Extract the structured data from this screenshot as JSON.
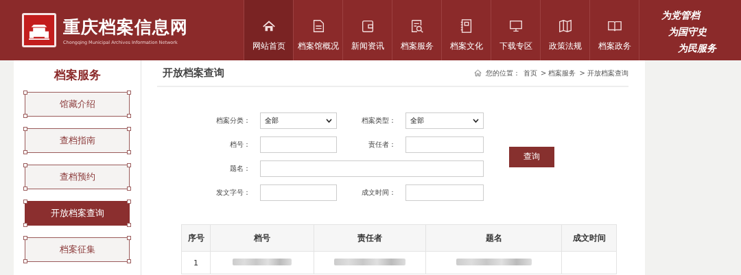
{
  "header": {
    "site_title": "重庆档案信息网",
    "site_subtitle": "Chongqing Municipal Archives Information Network",
    "nav": [
      {
        "label": "网站首页",
        "selected": true
      },
      {
        "label": "档案馆概况",
        "selected": false
      },
      {
        "label": "新闻资讯",
        "selected": false
      },
      {
        "label": "档案服务",
        "selected": false
      },
      {
        "label": "档案文化",
        "selected": false
      },
      {
        "label": "下载专区",
        "selected": false
      },
      {
        "label": "政策法规",
        "selected": false
      },
      {
        "label": "档案政务",
        "selected": false
      }
    ],
    "slogan": [
      "为党管档",
      "为国守史",
      "为民服务"
    ]
  },
  "sidebar": {
    "title": "档案服务",
    "items": [
      {
        "label": "馆藏介绍",
        "selected": false
      },
      {
        "label": "查档指南",
        "selected": false
      },
      {
        "label": "查档预约",
        "selected": false
      },
      {
        "label": "开放档案查询",
        "selected": true
      },
      {
        "label": "档案征集",
        "selected": false
      }
    ]
  },
  "page_title": "开放档案查询",
  "breadcrumb": {
    "prefix": "您的位置：",
    "items": [
      "首页",
      "> 档案服务",
      "> 开放档案查询"
    ]
  },
  "form": {
    "fields": [
      {
        "label": "档案分类：",
        "kind": "select",
        "value": "全部"
      },
      {
        "label": "档案类型：",
        "kind": "select",
        "value": "全部"
      },
      {
        "label": "档号：",
        "kind": "text"
      },
      {
        "label": "责任者：",
        "kind": "text"
      },
      {
        "label": "题名：",
        "kind": "wide"
      },
      {
        "label": "发文字号：",
        "kind": "text"
      },
      {
        "label": "成文时间：",
        "kind": "text"
      }
    ],
    "button": "查询"
  },
  "table": {
    "columns": [
      "序号",
      "档号",
      "责任者",
      "题名",
      "成文时间"
    ],
    "rows": [
      {
        "cells": [
          "1",
          null,
          null,
          null,
          ""
        ]
      }
    ]
  }
}
